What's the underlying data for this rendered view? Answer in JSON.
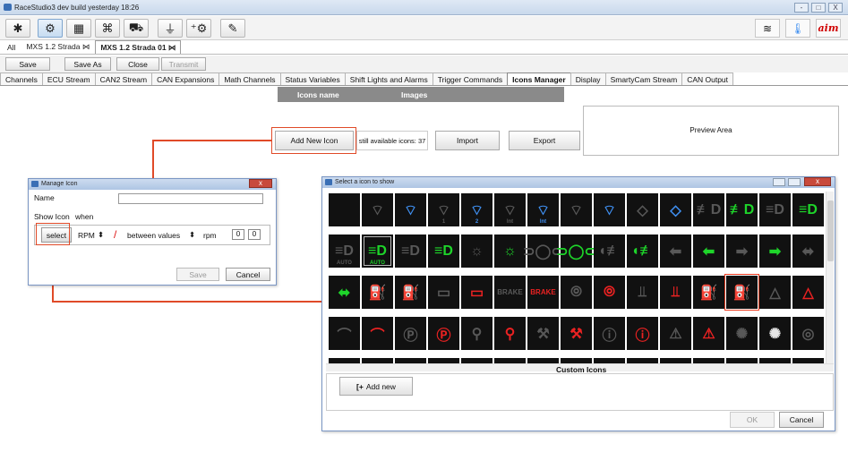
{
  "app": {
    "title": "RaceStudio3 dev  build yesterday 18:26",
    "window_buttons": [
      "-",
      "□",
      "X"
    ],
    "logo": "aim"
  },
  "toolbar": {
    "icons": [
      "wrench-icon",
      "gauge-icon",
      "chart-icon",
      "shape-icon",
      "car-icon",
      "ground-icon",
      "add-device-icon",
      "edit-icon"
    ],
    "right_icons": [
      "wifi-icon",
      "thermometer-icon"
    ]
  },
  "config_tabs": [
    {
      "label": "All"
    },
    {
      "label": "MXS 1.2 Strada ⋈"
    },
    {
      "label": "MXS 1.2 Strada 01 ⋈",
      "active": true
    }
  ],
  "actions": {
    "save": "Save",
    "save_as": "Save As",
    "close": "Close",
    "transmit": "Transmit"
  },
  "main_tabs": [
    "Channels",
    "ECU Stream",
    "CAN2 Stream",
    "CAN Expansions",
    "Math Channels",
    "Status Variables",
    "Shift Lights and Alarms",
    "Trigger Commands",
    "Icons Manager",
    "Display",
    "SmartyCam Stream",
    "CAN Output"
  ],
  "main_tabs_active": "Icons Manager",
  "icons_table": {
    "col_name": "Icons name",
    "col_images": "Images"
  },
  "buttons": {
    "add_new_icon": "Add New Icon",
    "available": "still available icons: 37",
    "import": "Import",
    "export": "Export"
  },
  "preview": {
    "label": "Preview Area"
  },
  "manage_dialog": {
    "title": "Manage Icon",
    "name_label": "Name",
    "name_value": "",
    "show_icon": "Show Icon",
    "when": "when",
    "select": "select",
    "channel": "RPM",
    "condition": "between values",
    "unit": "rpm",
    "min": "0",
    "max": "0",
    "save": "Save",
    "cancel": "Cancel"
  },
  "select_dialog": {
    "title": "Select a icon to show",
    "custom_icons": "Custom Icons",
    "add_new": "Add new",
    "ok": "OK",
    "cancel": "Cancel"
  },
  "icon_rows": [
    [
      {
        "n": "blank",
        "g": "",
        "c": "w"
      },
      {
        "n": "wiper-dim",
        "g": "⌔",
        "c": "d"
      },
      {
        "n": "wiper-blue",
        "g": "⌔",
        "c": "b"
      },
      {
        "n": "wiper-1-dim",
        "g": "⌔",
        "c": "d"
      },
      {
        "n": "wiper-2-blue",
        "g": "⌔",
        "c": "b"
      },
      {
        "n": "wiper-int-dim",
        "g": "⌔",
        "c": "d"
      },
      {
        "n": "wiper-int-blue",
        "g": "⌔",
        "c": "b"
      },
      {
        "n": "washer-dim",
        "g": "⌔",
        "c": "d"
      },
      {
        "n": "washer-blue",
        "g": "⌔",
        "c": "b"
      },
      {
        "n": "rear-wiper-dim",
        "g": "◇",
        "c": "d"
      },
      {
        "n": "rear-wiper-blue",
        "g": "◇",
        "c": "b"
      },
      {
        "n": "high-beam-dim",
        "g": "≢D",
        "c": "d"
      },
      {
        "n": "high-beam-green",
        "g": "≢D",
        "c": "g"
      },
      {
        "n": "low-beam-dim",
        "g": "≡D",
        "c": "d"
      },
      {
        "n": "low-beam-green",
        "g": "≡D",
        "c": "g"
      }
    ],
    [
      {
        "n": "auto-beam-dim",
        "g": "≡D",
        "c": "d"
      },
      {
        "n": "auto-beam-green",
        "g": "≡D",
        "c": "g",
        "sel": true
      },
      {
        "n": "beam-dim",
        "g": "≡D",
        "c": "d"
      },
      {
        "n": "beam-green",
        "g": "≡D",
        "c": "g"
      },
      {
        "n": "light-dim",
        "g": "☼",
        "c": "d"
      },
      {
        "n": "light-green",
        "g": "☼",
        "c": "g"
      },
      {
        "n": "parking-dim",
        "g": "⊃◯⊂",
        "c": "d"
      },
      {
        "n": "parking-green",
        "g": "⊃◯⊂",
        "c": "g"
      },
      {
        "n": "fog-dim",
        "g": "◖≢",
        "c": "d"
      },
      {
        "n": "fog-green",
        "g": "◖≢",
        "c": "g"
      },
      {
        "n": "left-arrow-dim",
        "g": "⬅",
        "c": "d"
      },
      {
        "n": "left-arrow-green",
        "g": "⬅",
        "c": "g"
      },
      {
        "n": "right-arrow-dim",
        "g": "➡",
        "c": "d"
      },
      {
        "n": "right-arrow-green",
        "g": "➡",
        "c": "g"
      },
      {
        "n": "both-arrow-dim",
        "g": "⬌",
        "c": "d"
      }
    ],
    [
      {
        "n": "both-arrow-green",
        "g": "⬌",
        "c": "g"
      },
      {
        "n": "fuel-can-dim",
        "g": "⛽",
        "c": "d"
      },
      {
        "n": "fuel-can-red",
        "g": "⛽",
        "c": "r"
      },
      {
        "n": "battery-dim",
        "g": "▭",
        "c": "d"
      },
      {
        "n": "battery-red",
        "g": "▭",
        "c": "r"
      },
      {
        "n": "brake-dim",
        "g": "BRAKE",
        "c": "d",
        "sm": true
      },
      {
        "n": "brake-red",
        "g": "BRAKE",
        "c": "r",
        "sm": true
      },
      {
        "n": "brake-circle-dim",
        "g": "⦾",
        "c": "d"
      },
      {
        "n": "brake-circle-red",
        "g": "⦾",
        "c": "r"
      },
      {
        "n": "coolant-dim",
        "g": "⫫",
        "c": "d"
      },
      {
        "n": "coolant-red",
        "g": "⫫",
        "c": "r"
      },
      {
        "n": "fuel-dim",
        "g": "⛽",
        "c": "d"
      },
      {
        "n": "fuel-red",
        "g": "⛽",
        "c": "r",
        "hl": true
      },
      {
        "n": "hazard-dim",
        "g": "△",
        "c": "d"
      },
      {
        "n": "hazard-red",
        "g": "△",
        "c": "r"
      }
    ],
    [
      {
        "n": "oil-dim",
        "g": "⌒",
        "c": "d"
      },
      {
        "n": "oil-red",
        "g": "⌒",
        "c": "r"
      },
      {
        "n": "parking-brake-dim",
        "g": "Ⓟ",
        "c": "d"
      },
      {
        "n": "parking-brake-red",
        "g": "Ⓟ",
        "c": "r"
      },
      {
        "n": "seatbelt-dim",
        "g": "⚲",
        "c": "d"
      },
      {
        "n": "seatbelt-red",
        "g": "⚲",
        "c": "r"
      },
      {
        "n": "wrench-dim",
        "g": "⚒",
        "c": "d"
      },
      {
        "n": "wrench-red",
        "g": "⚒",
        "c": "r"
      },
      {
        "n": "info-dim",
        "g": "ⓘ",
        "c": "d"
      },
      {
        "n": "info-red",
        "g": "ⓘ",
        "c": "r"
      },
      {
        "n": "warning-dim",
        "g": "⚠",
        "c": "d"
      },
      {
        "n": "warning-red",
        "g": "⚠",
        "c": "r"
      },
      {
        "n": "turbo-dim",
        "g": "✺",
        "c": "d"
      },
      {
        "n": "turbo-white",
        "g": "✺",
        "c": "w"
      },
      {
        "n": "abs-dim",
        "g": "◎",
        "c": "d"
      }
    ],
    [
      {
        "n": "more-1",
        "g": "▁",
        "c": "w"
      },
      {
        "n": "more-2",
        "g": "▁",
        "c": "d"
      },
      {
        "n": "more-3",
        "g": "▁",
        "c": "d"
      },
      {
        "n": "more-4",
        "g": "▁",
        "c": "d"
      },
      {
        "n": "more-5",
        "g": "▁",
        "c": "d"
      },
      {
        "n": "more-6",
        "g": "▁",
        "c": "d"
      },
      {
        "n": "more-7",
        "g": "▁",
        "c": "d"
      },
      {
        "n": "more-8",
        "g": "▁",
        "c": "d"
      },
      {
        "n": "more-9",
        "g": "▁",
        "c": "d"
      },
      {
        "n": "more-10",
        "g": "▁",
        "c": "d"
      },
      {
        "n": "more-11",
        "g": "▁",
        "c": "d"
      },
      {
        "n": "more-12",
        "g": "▁",
        "c": "d"
      },
      {
        "n": "more-13",
        "g": "▁",
        "c": "d"
      },
      {
        "n": "more-14",
        "g": "▁",
        "c": "d"
      },
      {
        "n": "more-15",
        "g": "▁",
        "c": "d"
      }
    ]
  ],
  "icon_sublabels": {
    "0.2": "",
    "0.3": "1",
    "0.4": "2",
    "0.5": "Int",
    "0.6": "Int",
    "1.0": "AUTO",
    "1.1": "AUTO"
  },
  "colors": {
    "accent_red": "#e04a28",
    "icon_green": "#1ed52a",
    "icon_blue": "#3f8ff0",
    "icon_red": "#ea2222",
    "header_gray": "#8a8a8a"
  }
}
